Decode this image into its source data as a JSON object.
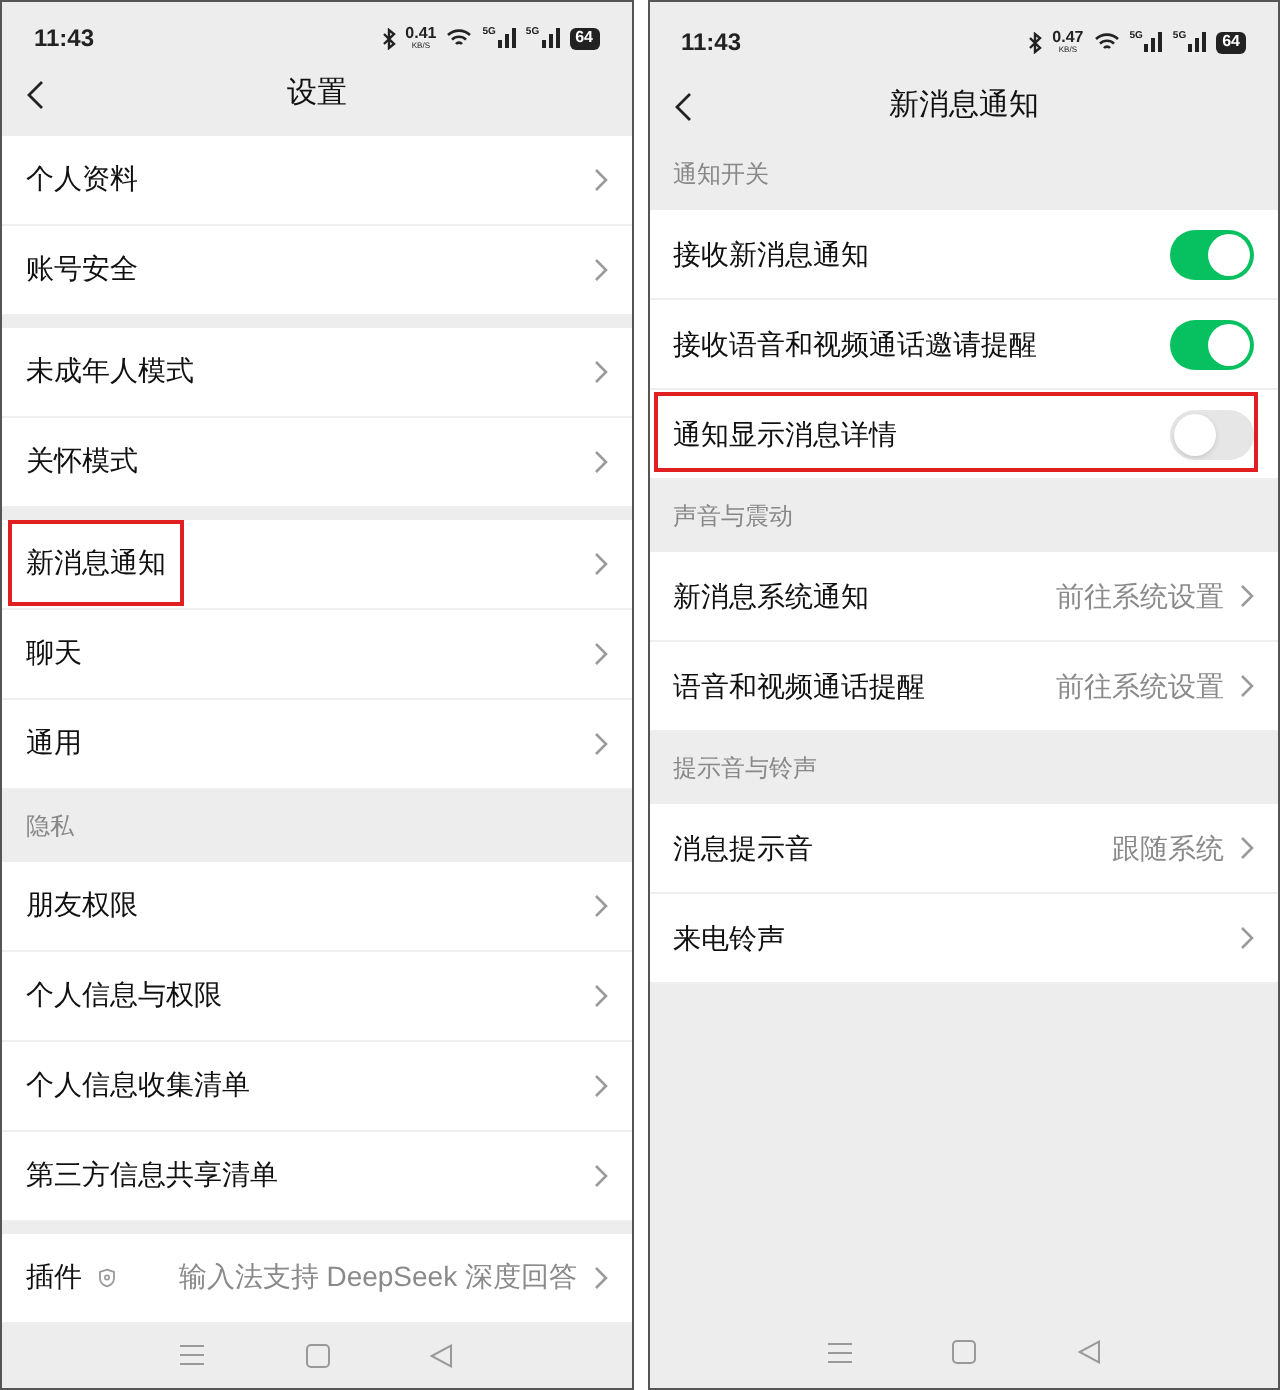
{
  "screens": [
    {
      "status": {
        "time": "11:43",
        "speed": "0.41",
        "speed_unit": "KB/S",
        "signal_labels": [
          "5G",
          "5G"
        ],
        "battery": "64"
      },
      "title": "设置",
      "groups": [
        {
          "items": [
            {
              "kind": "link",
              "label": "个人资料",
              "highlighted": false
            },
            {
              "kind": "link",
              "label": "账号安全",
              "highlighted": false
            }
          ]
        },
        {
          "items": [
            {
              "kind": "link",
              "label": "未成年人模式",
              "highlighted": false
            },
            {
              "kind": "link",
              "label": "关怀模式",
              "highlighted": false
            }
          ]
        },
        {
          "items": [
            {
              "kind": "link",
              "label": "新消息通知",
              "highlighted": true
            },
            {
              "kind": "link",
              "label": "聊天",
              "highlighted": false
            },
            {
              "kind": "link",
              "label": "通用",
              "highlighted": false
            }
          ]
        },
        {
          "header": "隐私",
          "items": [
            {
              "kind": "link",
              "label": "朋友权限",
              "highlighted": false
            },
            {
              "kind": "link",
              "label": "个人信息与权限",
              "highlighted": false
            },
            {
              "kind": "link",
              "label": "个人信息收集清单",
              "highlighted": false
            },
            {
              "kind": "link",
              "label": "第三方信息共享清单",
              "highlighted": false
            }
          ]
        },
        {
          "items": [
            {
              "kind": "link",
              "label": "插件",
              "shield": true,
              "value": "输入法支持 DeepSeek 深度回答",
              "highlighted": false
            }
          ]
        }
      ]
    },
    {
      "status": {
        "time": "11:43",
        "speed": "0.47",
        "speed_unit": "KB/S",
        "signal_labels": [
          "5G",
          "5G"
        ],
        "battery": "64"
      },
      "title": "新消息通知",
      "groups": [
        {
          "header": "通知开关",
          "items": [
            {
              "kind": "switch",
              "label": "接收新消息通知",
              "on": true,
              "highlighted": false
            },
            {
              "kind": "switch",
              "label": "接收语音和视频通话邀请提醒",
              "on": true,
              "highlighted": false
            },
            {
              "kind": "switch",
              "label": "通知显示消息详情",
              "on": false,
              "highlighted": true
            }
          ]
        },
        {
          "header": "声音与震动",
          "items": [
            {
              "kind": "link",
              "label": "新消息系统通知",
              "value": "前往系统设置",
              "highlighted": false
            },
            {
              "kind": "link",
              "label": "语音和视频通话提醒",
              "value": "前往系统设置",
              "highlighted": false
            }
          ]
        },
        {
          "header": "提示音与铃声",
          "items": [
            {
              "kind": "link",
              "label": "消息提示音",
              "value": "跟随系统",
              "highlighted": false
            },
            {
              "kind": "link",
              "label": "来电铃声",
              "highlighted": false
            }
          ]
        }
      ]
    }
  ]
}
